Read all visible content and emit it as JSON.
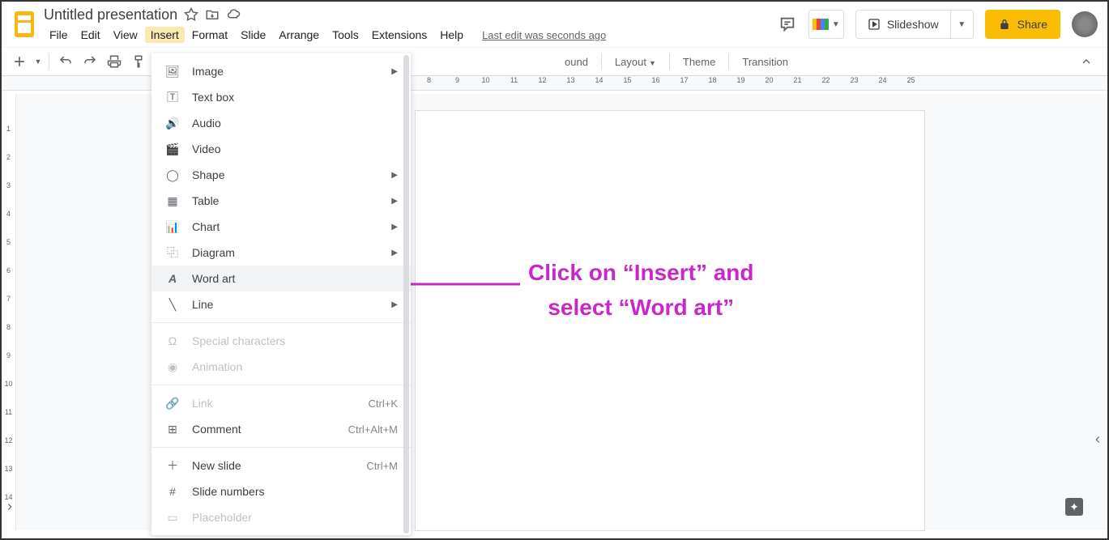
{
  "doc_title": "Untitled presentation",
  "menus": {
    "file": "File",
    "edit": "Edit",
    "view": "View",
    "insert": "Insert",
    "format": "Format",
    "slide": "Slide",
    "arrange": "Arrange",
    "tools": "Tools",
    "extensions": "Extensions",
    "help": "Help"
  },
  "last_edit": "Last edit was seconds ago",
  "header_buttons": {
    "slideshow": "Slideshow",
    "share": "Share"
  },
  "toolbar": {
    "background": "ound",
    "layout": "Layout",
    "theme": "Theme",
    "transition": "Transition"
  },
  "insert_menu": {
    "image": "Image",
    "textbox": "Text box",
    "audio": "Audio",
    "video": "Video",
    "shape": "Shape",
    "table": "Table",
    "chart": "Chart",
    "diagram": "Diagram",
    "wordart": "Word art",
    "line": "Line",
    "specialchars": "Special characters",
    "animation": "Animation",
    "link": "Link",
    "comment": "Comment",
    "newslide": "New slide",
    "slidenumbers": "Slide numbers",
    "placeholder": "Placeholder"
  },
  "shortcuts": {
    "link": "Ctrl+K",
    "comment": "Ctrl+Alt+M",
    "newslide": "Ctrl+M"
  },
  "annotation": {
    "line1": "Click on “Insert” and",
    "line2": "select “Word art”"
  },
  "ruler_h": [
    "8",
    "9",
    "10",
    "11",
    "12",
    "13",
    "14",
    "15",
    "16",
    "17",
    "18",
    "19",
    "20",
    "21",
    "22",
    "23",
    "24",
    "25"
  ],
  "ruler_v": [
    "",
    "1",
    "2",
    "3",
    "4",
    "5",
    "6",
    "7",
    "8",
    "9",
    "10",
    "11",
    "12",
    "13",
    "14"
  ]
}
